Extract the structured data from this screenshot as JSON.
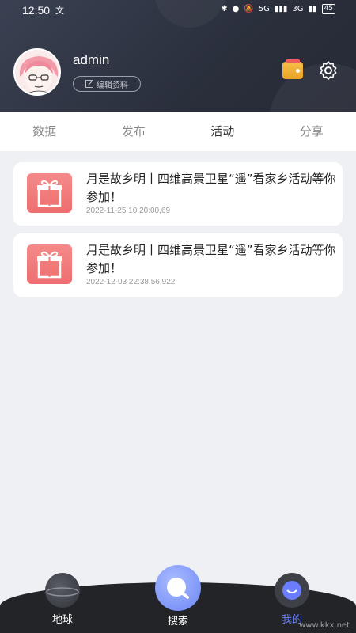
{
  "status_bar": {
    "time": "12:50",
    "extra": "文",
    "network": "5G",
    "network2": "3G",
    "battery": "45"
  },
  "profile": {
    "username": "admin",
    "edit_label": "编辑资料"
  },
  "tabs": [
    {
      "label": "数据",
      "active": false
    },
    {
      "label": "发布",
      "active": false
    },
    {
      "label": "活动",
      "active": true
    },
    {
      "label": "分享",
      "active": false
    }
  ],
  "activities": [
    {
      "title": "月是故乡明丨四维高景卫星“遥”看家乡活动等你参加！",
      "time": "2022-11-25 10:20:00,69"
    },
    {
      "title": "月是故乡明丨四维高景卫星“遥”看家乡活动等你参加！",
      "time": "2022-12-03 22:38:56,922"
    }
  ],
  "bottom_nav": [
    {
      "label": "地球",
      "icon": "planet-icon"
    },
    {
      "label": "搜索",
      "icon": "search-bubble-icon"
    },
    {
      "label": "我的",
      "icon": "profile-icon",
      "active": true
    }
  ],
  "watermark": "www.kkx.net",
  "colors": {
    "accent": "#6a7cff",
    "header": "#2f3440",
    "gift": "#f07878"
  }
}
